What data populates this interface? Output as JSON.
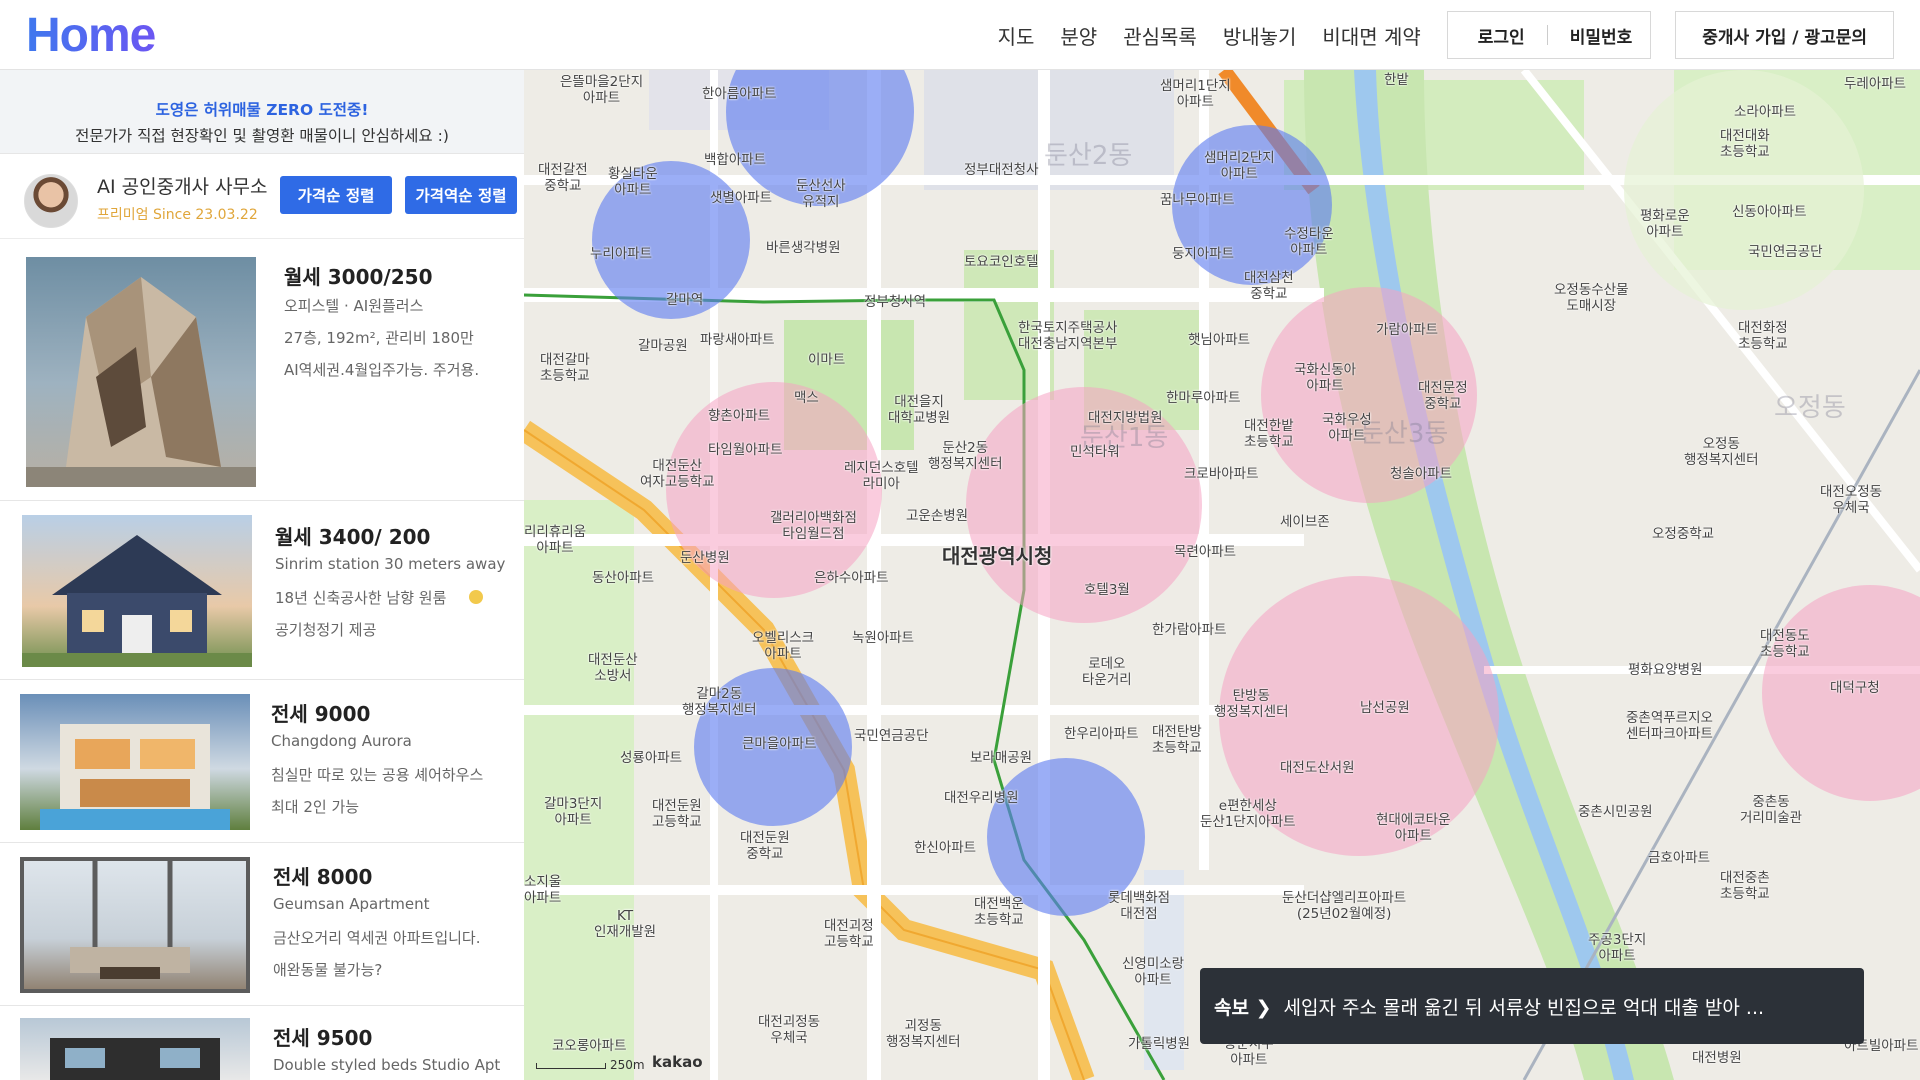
{
  "header": {
    "logo": "Home",
    "nav": [
      "지도",
      "분양",
      "관심목록",
      "방내놓기",
      "비대면 계약"
    ],
    "login": "로그인",
    "password": "비밀번호",
    "agent_signup": "중개사 가입 / 광고문의"
  },
  "sidebar": {
    "notice_title": "도영은 허위매물 ZERO 도전중!",
    "notice_body": "전문가가 직접 현장확인 및 촬영환 매물이니 안심하세요 :)",
    "agent_name": "AI 공인중개사 사무소",
    "agent_since": "프리미엄 Since 23.03.22",
    "sort_price_asc": "가격순 정렬",
    "sort_price_desc": "가격역순 정렬",
    "listings": [
      {
        "price": "월세 3000/250",
        "l1": "오피스텔 · AI원플러스",
        "l2": "27층, 192m², 관리비 180만",
        "l3": "AI역세권.4월입주가능. 주거용."
      },
      {
        "price": "월세 3400/ 200",
        "l1": "Sinrim station 30 meters away",
        "l2": "18년 신축공사한 남향 원룸",
        "l3": "공기청정기 제공"
      },
      {
        "price": "전세 9000",
        "l1": "Changdong Aurora",
        "l2": "침실만 따로 있는 공용 셰어하우스",
        "l3": "최대 2인 가능"
      },
      {
        "price": "전세 8000",
        "l1": "Geumsan Apartment",
        "l2": "금산오거리 역세권 아파트입니다.",
        "l3": "애완동물 불가능?"
      },
      {
        "price": "전세 9500",
        "l1": "Double styled beds Studio Apt",
        "l2": "",
        "l3": ""
      }
    ]
  },
  "map": {
    "labels": {
      "l01": "은뜰마을2단지\n아파트",
      "l02": "한아름아파트",
      "l03": "샘머리1단지\n아파트",
      "l04": "한밭",
      "l05": "대전갈전\n중학교",
      "l06": "황실타운\n아파트",
      "l07": "백합아파트",
      "l08": "둔산선사\n유적지",
      "l09": "정부대전청사",
      "l10": "샘머리2단지\n아파트",
      "l11": "샛별아파트",
      "l12": "꿈나무아파트",
      "l13": "누리아파트",
      "l14": "바른생각병원",
      "l15": "토요코인호텔",
      "l16": "둥지아파트",
      "l17": "수정타운\n아파트",
      "l18": "갈마역",
      "l19": "정부청사역",
      "l20": "대전삼천\n중학교",
      "l21": "갈마공원",
      "l22": "파랑새아파트",
      "l23": "이마트",
      "l24": "한국토지주택공사\n대전충남지역본부",
      "l25": "햇님아파트",
      "l26": "가람아파트",
      "l27": "대전갈마\n초등학교",
      "l28": "맥스",
      "l29": "대전을지\n대학교병원",
      "l30": "한마루아파트",
      "l31": "국화신동아\n아파트",
      "l32": "대전문정\n중학교",
      "l33": "향촌아파트",
      "l34": "둔산2동\n행정복지센터",
      "l35": "대전지방법원",
      "l36": "대전한밭\n초등학교",
      "l37": "국화우성\n아파트",
      "l38": "타임월아파트",
      "l39": "레지던스호텔\n라미아",
      "l40": "민석타워",
      "l41": "크로바아파트",
      "l42": "청솔아파트",
      "l43": "대전둔산\n여자고등학교",
      "l44": "고운손병원",
      "l45": "세이브존",
      "l46": "갤러리아백화점\n타임월드점",
      "l47": "목련아파트",
      "l48": "둔산병원",
      "l49": "대전광역시청",
      "l50": "호텔3월",
      "l51": "은하수아파트",
      "l52": "한가람아파트",
      "l53": "오벨리스크\n아파트",
      "l54": "녹원아파트",
      "l55": "대전둔산\n소방서",
      "l56": "로데오\n타운거리",
      "l57": "탄방동\n행정복지센터",
      "l58": "남선공원",
      "l59": "갈마2동\n행정복지센터",
      "l60": "큰마을아파트",
      "l61": "국민연금공단",
      "l62": "한우리아파트",
      "l63": "대전탄방\n초등학교",
      "l64": "성룡아파트",
      "l65": "보라매공원",
      "l66": "대전도산서원",
      "l67": "갈마3단지\n아파트",
      "l68": "대전둔원\n고등학교",
      "l69": "대전우리병원",
      "l70": "대전둔원\n중학교",
      "l71": "e편한세상\n둔산1단지아파트",
      "l72": "현대에코타운\n아파트",
      "l73": "한신아파트",
      "l74": "롯데백화점\n대전점",
      "l75": "대전백운\n초등학교",
      "l76": "KT\n인재개발원",
      "l77": "대전괴정\n고등학교",
      "l78": "둔산더샵엘리프아파트\n(25년02월예정)",
      "l79": "신영미소랑\n아파트",
      "l80": "대전괴정동\n우체국",
      "l81": "괴정동\n행정복지센터",
      "l82": "가톨릭병원",
      "l83": "코오롱아파트",
      "l84": "용문서우\n아파트",
      "l85": "두레아파트",
      "l86": "소라아파트",
      "l87": "대전대화\n초등학교",
      "l88": "평화로운\n아파트",
      "l89": "신동아아파트",
      "l90": "국민연금공단",
      "l91": "오정동수산물\n도매시장",
      "l92": "대전화정\n초등학교",
      "l93": "오정동\n행정복지센터",
      "l94": "오정중학교",
      "l95": "대전오정동\n우체국",
      "l96": "대전동도\n초등학교",
      "l97": "대덕구청",
      "l98": "평화요양병원",
      "l99": "중촌역푸르지오\n센터파크아파트",
      "l100": "중촌시민공원",
      "l101": "중촌동\n거리미술관",
      "l102": "금호아파트",
      "l103": "대전중촌\n초등학교",
      "l104": "주공3단지\n아파트",
      "l105": "대전병원",
      "l106": "아트빌아파트",
      "l107": "소지울\n아파트",
      "l108": "리리휴리움\n아파트",
      "l109": "동산아파트",
      "l110": "둔산2동",
      "l111": "둔산1동",
      "l112": "둔산3동",
      "l113": "오정동"
    },
    "scale": "250m",
    "brand": "kakao"
  },
  "news": {
    "tag": "속보 ❯",
    "text": "세입자 주소 몰래 옮긴 뒤 서류상 빈집으로 억대 대출 받아 ..."
  }
}
